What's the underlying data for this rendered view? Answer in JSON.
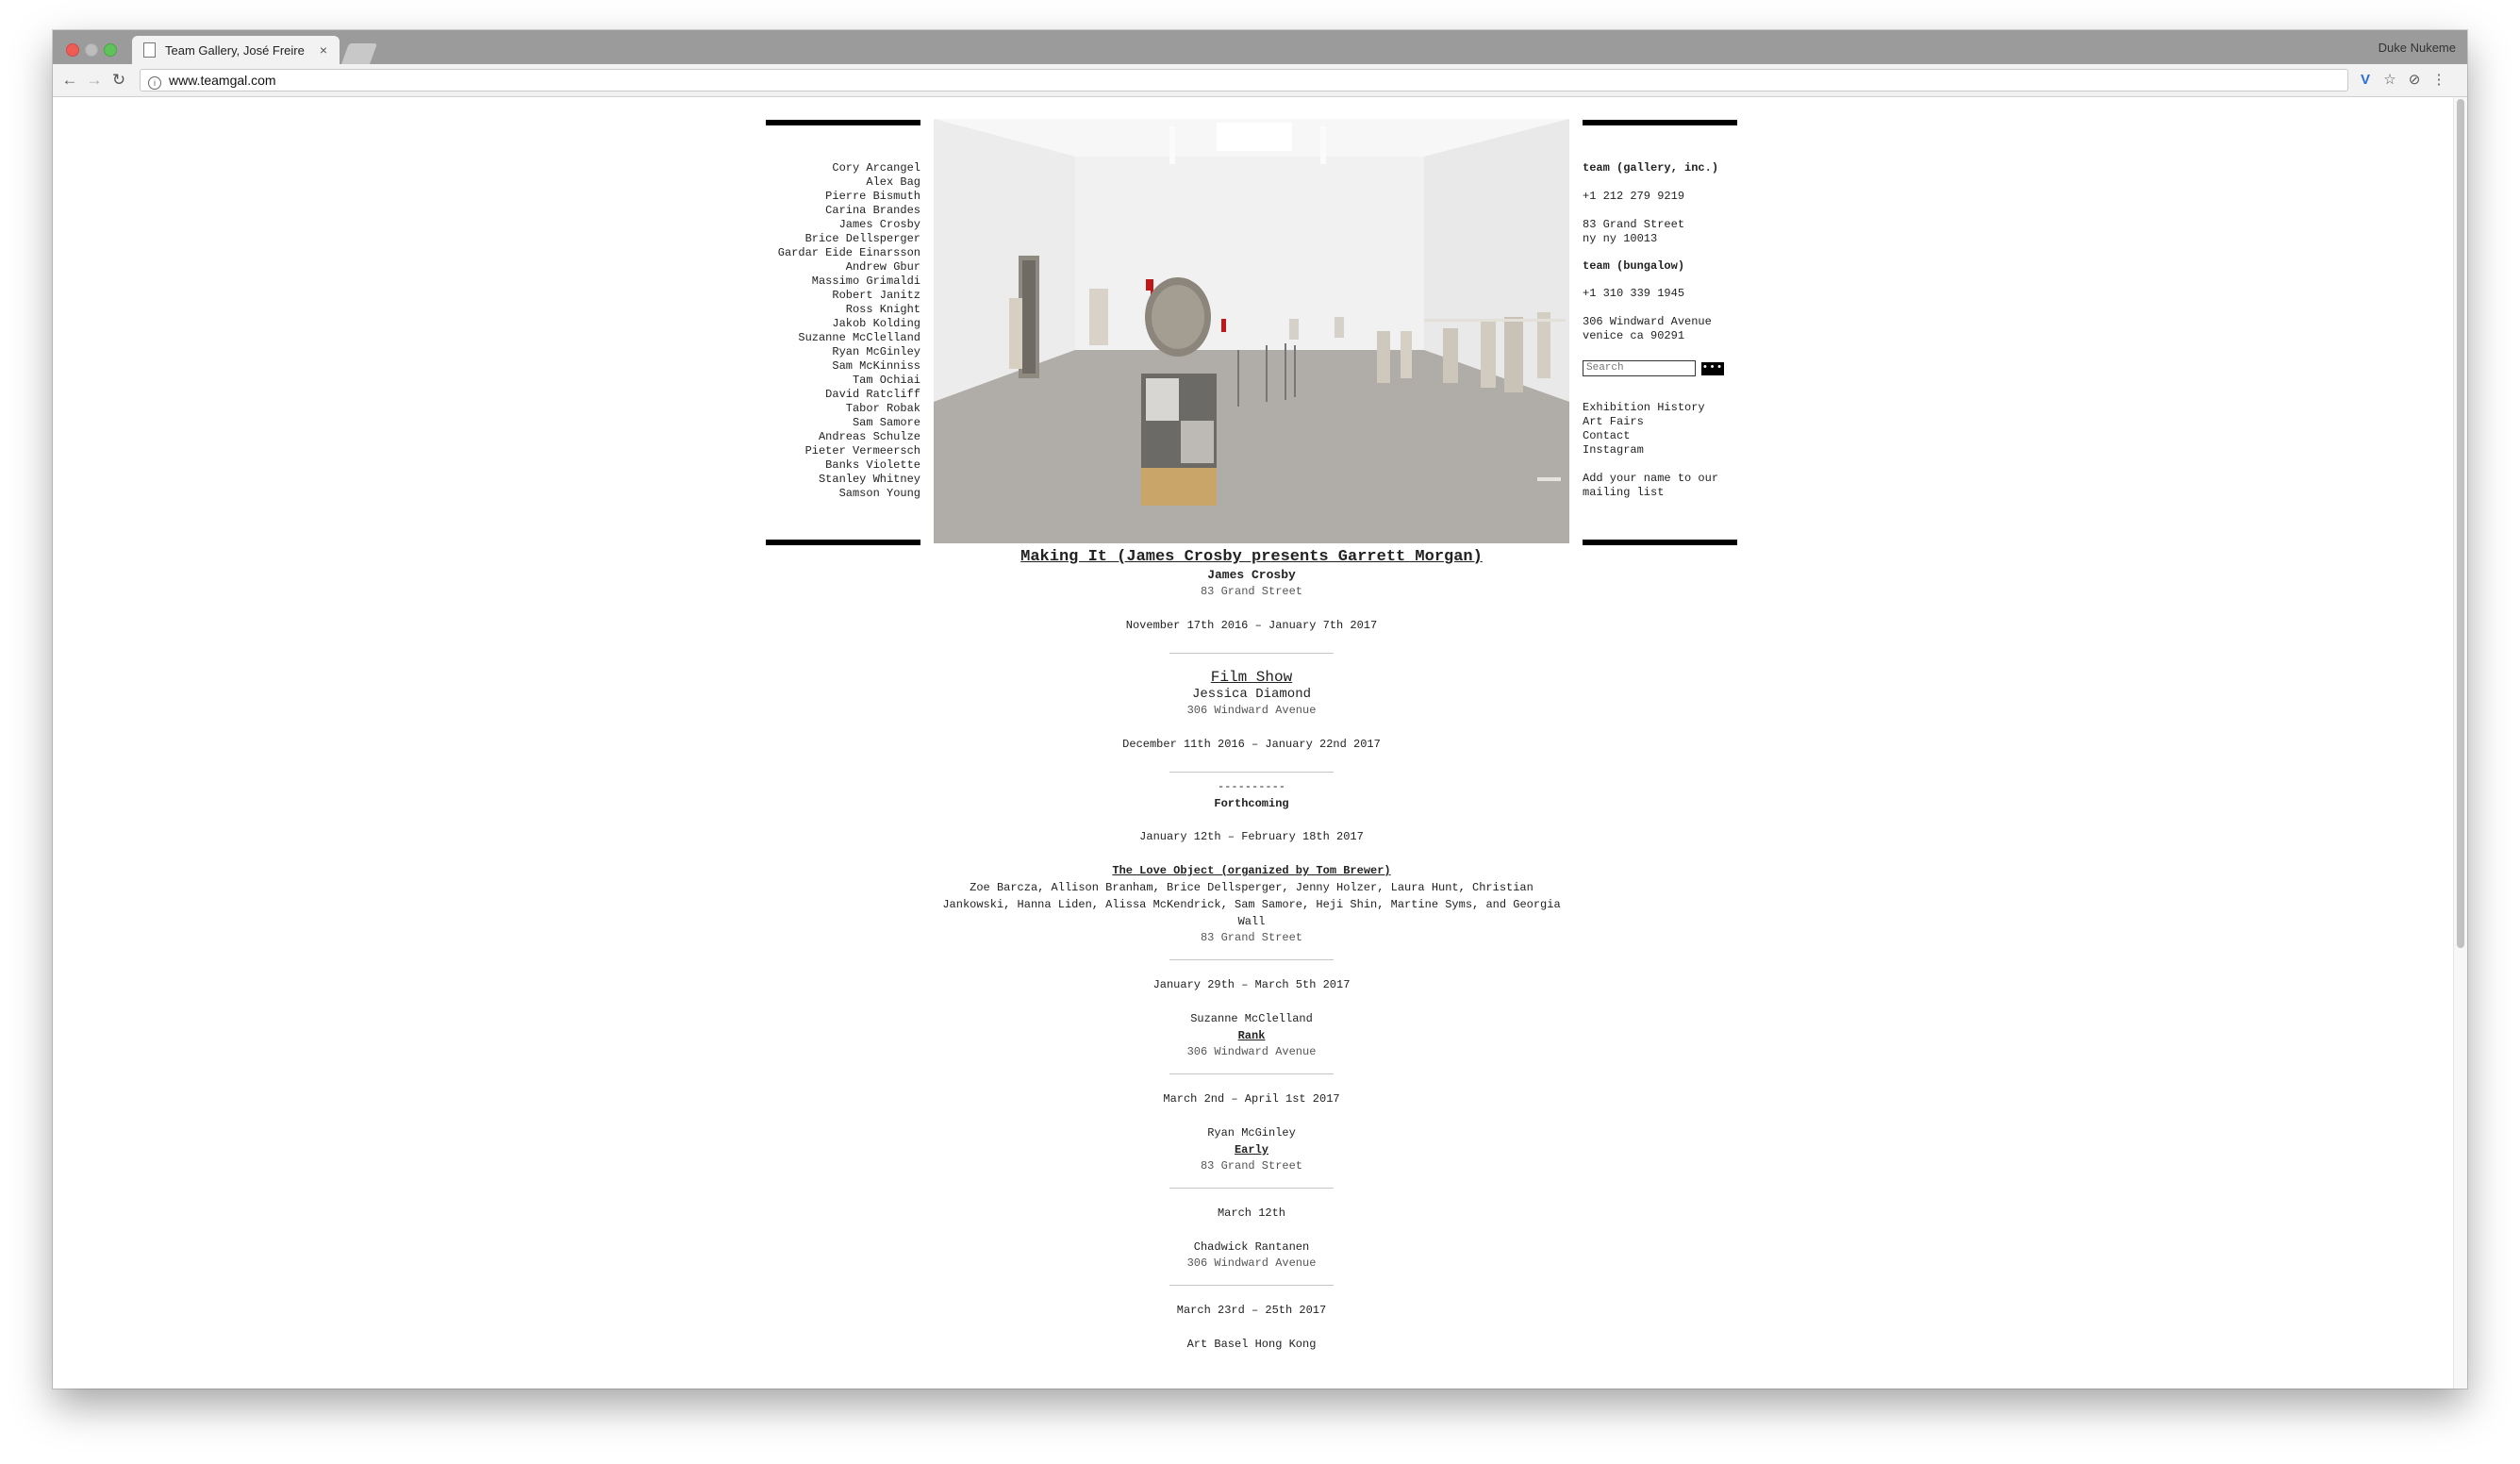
{
  "browser": {
    "tab_title": "Team Gallery, José Freire",
    "profile_name": "Duke Nukeme",
    "url": "www.teamgal.com"
  },
  "artists": [
    "Cory Arcangel",
    "Alex Bag",
    "Pierre Bismuth",
    "Carina Brandes",
    "James Crosby",
    "Brice Dellsperger",
    "Gardar Eide Einarsson",
    "Andrew Gbur",
    "Massimo Grimaldi",
    "Robert Janitz",
    "Ross Knight",
    "Jakob Kolding",
    "Suzanne McClelland",
    "Ryan McGinley",
    "Sam McKinniss",
    "Tam Ochiai",
    "David Ratcliff",
    "Tabor Robak",
    "Sam Samore",
    "Andreas Schulze",
    "Pieter Vermeersch",
    "Banks Violette",
    "Stanley Whitney",
    "Samson Young"
  ],
  "contact": {
    "gallery_name": "team (gallery, inc.)",
    "gallery_phone": "+1 212 279 9219",
    "gallery_address_1": "83 Grand Street",
    "gallery_address_2": "ny ny 10013",
    "bungalow_name": "team (bungalow)",
    "bungalow_phone": "+1 310 339 1945",
    "bungalow_address_1": "306 Windward Avenue",
    "bungalow_address_2": "venice ca 90291"
  },
  "search": {
    "placeholder": "Search",
    "button_label": "•••"
  },
  "links": {
    "exhibition_history": "Exhibition History",
    "art_fairs": "Art Fairs",
    "contact": "Contact",
    "instagram": "Instagram",
    "mailing_1": "Add your name to our",
    "mailing_2": "mailing list"
  },
  "current": [
    {
      "title": "Making It (James Crosby presents Garrett Morgan)",
      "artist": "James Crosby",
      "location": "83 Grand Street",
      "dates": "November 17th 2016 – January 7th 2017"
    },
    {
      "title": "Film Show",
      "artist": "Jessica Diamond",
      "location": "306 Windward Avenue",
      "dates": "December 11th 2016 – January 22nd 2017"
    }
  ],
  "forthcoming": {
    "dashes": "----------",
    "label": "Forthcoming",
    "items": [
      {
        "dates": "January 12th – February 18th 2017",
        "title": "The Love Object (organized by Tom Brewer)",
        "artists": "Zoe Barcza, Allison Branham, Brice Dellsperger, Jenny Holzer, Laura Hunt, Christian Jankowski, Hanna Liden, Alissa McKendrick, Sam Samore, Heji Shin, Martine Syms, and Georgia Wall",
        "location": "83 Grand Street"
      },
      {
        "dates": "January 29th – March 5th 2017",
        "artist": "Suzanne McClelland",
        "title": "Rank",
        "location": "306 Windward Avenue"
      },
      {
        "dates": "March 2nd – April 1st 2017",
        "artist": "Ryan McGinley",
        "title": "Early",
        "location": "83 Grand Street"
      },
      {
        "dates": "March 12th",
        "artist": "Chadwick Rantanen",
        "location": "306 Windward Avenue"
      },
      {
        "dates": "March 23rd – 25th 2017",
        "partial": "Art Basel Hong Kong"
      }
    ]
  }
}
